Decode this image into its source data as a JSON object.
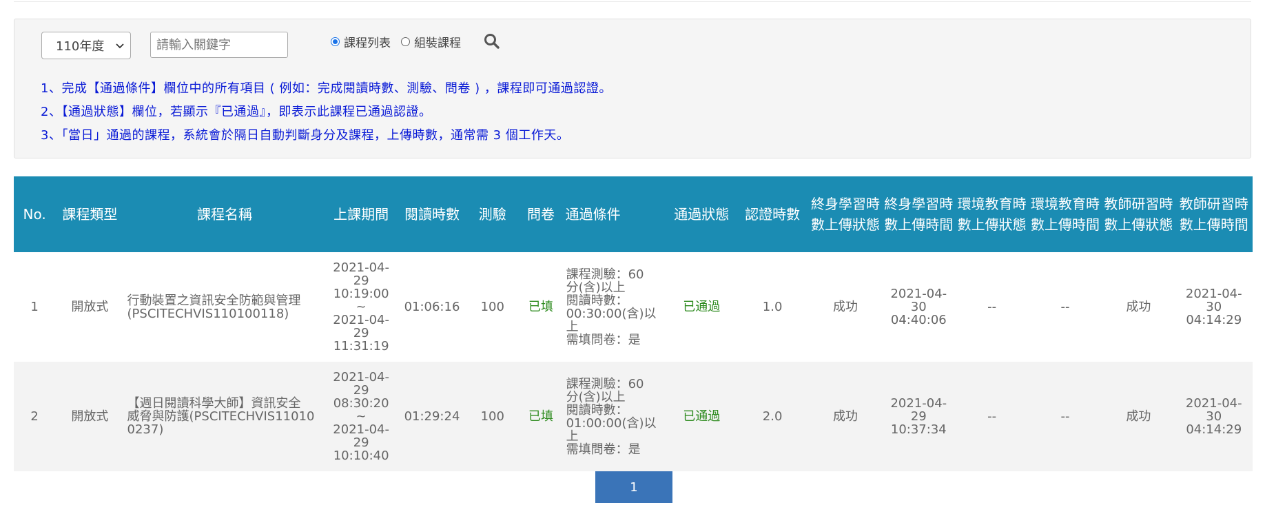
{
  "filter": {
    "year_selected": "110年度",
    "keyword_placeholder": "請輸入關鍵字",
    "radio_course_list": "課程列表",
    "radio_assembled": "組裝課程",
    "search_icon": "magnifier"
  },
  "notes": [
    "1、完成【通過條件】欄位中的所有項目 ( 例如：完成閱讀時數、測驗、問卷 ) ，課程即可通過認證。",
    "2、【通過狀態】欄位，若顯示『已通過』，即表示此課程已通過認證。",
    "3、「當日」通過的課程，系統會於隔日自動判斷身分及課程，上傳時數，通常需 3 個工作天。"
  ],
  "table": {
    "headers": {
      "no": "No.",
      "type": "課程類型",
      "name": "課程名稱",
      "period": "上課期間",
      "read_hours": "閱讀時數",
      "test": "測驗",
      "survey": "問卷",
      "condition": "通過條件",
      "status": "通過狀態",
      "cert_hours": "認證時數",
      "lifelong_status": "終身學習時數上傳狀態",
      "lifelong_time": "終身學習時數上傳時間",
      "env_status": "環境教育時數上傳狀態",
      "env_time": "環境教育時數上傳時間",
      "teacher_status": "教師研習時數上傳狀態",
      "teacher_time": "教師研習時數上傳時間"
    },
    "rows": [
      {
        "no": "1",
        "type": "開放式",
        "name_l1": "行動裝置之資訊安全防範與管理",
        "name_l2": "(PSCITECHVIS110100118)",
        "period_l1": "2021-04-",
        "period_l2": "29",
        "period_l3": "10:19:00",
        "period_l4": "~",
        "period_l5": "2021-04-",
        "period_l6": "29",
        "period_l7": "11:31:19",
        "read_hours": "01:06:16",
        "test": "100",
        "survey": "已填",
        "cond_l1": "課程測驗：60",
        "cond_l2": "分(含)以上",
        "cond_l3": "閱讀時數：",
        "cond_l4": "00:30:00(含)以",
        "cond_l5": "上",
        "cond_l6": "需填問卷：是",
        "status": "已通過",
        "cert_hours": "1.0",
        "lifelong_status": "成功",
        "lifelong_time_l1": "2021-04-",
        "lifelong_time_l2": "30",
        "lifelong_time_l3": "04:40:06",
        "env_status": "--",
        "env_time": "--",
        "teacher_status": "成功",
        "teacher_time_l1": "2021-04-",
        "teacher_time_l2": "30",
        "teacher_time_l3": "04:14:29"
      },
      {
        "no": "2",
        "type": "開放式",
        "name_l1": "【週日閱讀科學大師】資訊安全",
        "name_l2": "威脅與防護(PSCITECHVIS11010",
        "name_l3": "0237)",
        "period_l1": "2021-04-",
        "period_l2": "29",
        "period_l3": "08:30:20",
        "period_l4": "~",
        "period_l5": "2021-04-",
        "period_l6": "29",
        "period_l7": "10:10:40",
        "read_hours": "01:29:24",
        "test": "100",
        "survey": "已填",
        "cond_l1": "課程測驗：60",
        "cond_l2": "分(含)以上",
        "cond_l3": "閱讀時數：",
        "cond_l4": "01:00:00(含)以",
        "cond_l5": "上",
        "cond_l6": "需填問卷：是",
        "status": "已通過",
        "cert_hours": "2.0",
        "lifelong_status": "成功",
        "lifelong_time_l1": "2021-04-",
        "lifelong_time_l2": "29",
        "lifelong_time_l3": "10:37:34",
        "env_status": "--",
        "env_time": "--",
        "teacher_status": "成功",
        "teacher_time_l1": "2021-04-",
        "teacher_time_l2": "30",
        "teacher_time_l3": "04:14:29"
      }
    ]
  },
  "pagination": {
    "current": "1"
  },
  "colors": {
    "header_bg": "#1b8cb3",
    "note_text": "#0a1bd6",
    "passed_text": "#2e8b1f",
    "pager_bg": "#3a74b8"
  }
}
